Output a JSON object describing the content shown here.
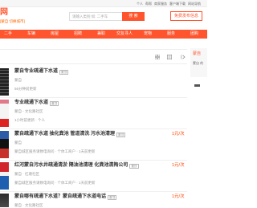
{
  "theme": {
    "accent": "#ff552e",
    "price": "#ff4400"
  },
  "topbar": {
    "links": [
      "个人",
      "帮帮",
      "商家服务",
      "客户端下载",
      "网站导航"
    ]
  },
  "header": {
    "logo_text": "网",
    "city": "[蒙自 切换城市]",
    "search_placeholder": "请输入类别 如: 二手车",
    "search_button": "搜 索",
    "post_button": "免费发布信息"
  },
  "nav": {
    "items": [
      "二手",
      "车辆",
      "房屋",
      "招聘",
      "兼职",
      "交友寻人",
      "宠物",
      "服务",
      "团购"
    ]
  },
  "toolbar": {
    "icons": [
      "grid-view-icon",
      "list-view-icon",
      "next-page-icon"
    ]
  },
  "sidebar": {
    "title": "蒙自",
    "subtitle": "蒙自 的"
  },
  "listings": [
    {
      "title": "蒙自专业疏通下水道",
      "tag": "置顶",
      "location": "蒙自",
      "meta": "56分钟前更新"
    },
    {
      "title": "专业疏通下水道",
      "tag": "置顶",
      "location": "蒙自 - 文化路社区",
      "meta": "1小时前更新 · 个人"
    },
    {
      "title": "蒙自疏通下水道 抽化粪池 管道清洗 污水池清理",
      "tag": "置顶",
      "location": "蒙自",
      "meta": "蒙自城区服务请致电询问 · 个体工商户 · 1天前更新",
      "price": "1元/次"
    },
    {
      "title": "红河蒙自污水井疏通清淤 隔油池清理 化粪池清掏公司",
      "tag": "置顶",
      "location": "蒙自 · 红塘社区",
      "meta": "蒙自城区服务请致电询问 · 个体工商户 · 1天前更新",
      "price": "1元/次"
    },
    {
      "title": "蒙自哪有疏通下水道？蒙自疏通下水道电话",
      "tag": "置顶",
      "location": "蒙自 · 文化路社区",
      "price": "1元/次"
    }
  ]
}
